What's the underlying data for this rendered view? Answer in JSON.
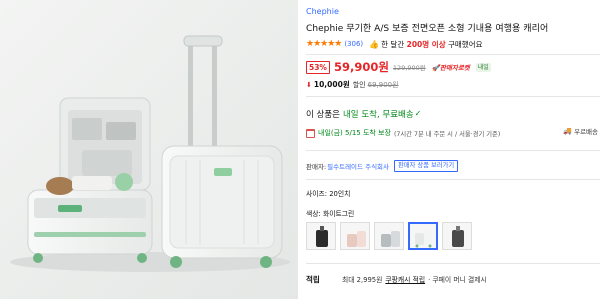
{
  "product": {
    "brand": "Chephie",
    "title": "Chephie 무기한 A/S 보증 전면오픈 소형 기내용 여행용 캐리어",
    "stars": "★★★★★",
    "review_count": "(306)",
    "sales_prefix": "한 달간",
    "sales_count": "200명 이상",
    "sales_suffix": "구매했어요"
  },
  "price": {
    "discount_rate": "53%",
    "sale_price": "59,900원",
    "original_price": "129,900원",
    "rocket_label": "판매자로켓",
    "tomorrow_badge": "내일",
    "coupon_discount": "10,000원",
    "coupon_label": "할인",
    "coupon_price": "69,900원"
  },
  "shipping": {
    "lead": "이 상품은",
    "day": "내일 도착, 무료배송",
    "delivery_date": "내일(금) 5/15 도착 보장",
    "delivery_note": "(7시간 7분 내 주문 시 / 서울·경기 기준)",
    "ask_label": "우르배송"
  },
  "seller": {
    "label": "판매자:",
    "name": "필수트레이드 주식회사",
    "more_button": "판매자 상품 보러가기"
  },
  "options": {
    "size": "사이즈: 20인치",
    "color": "색상: 화이트그린"
  },
  "points": {
    "label": "적립",
    "text": "최대 2,995원",
    "link": "쿠팡캐시 적립",
    "extra": "· 쿠페이 머니 결제시"
  },
  "colors": {
    "brand_blue": "#346aff",
    "sale_red": "#e52528",
    "star_orange": "#ff7a00",
    "ship_green": "#00891a"
  }
}
